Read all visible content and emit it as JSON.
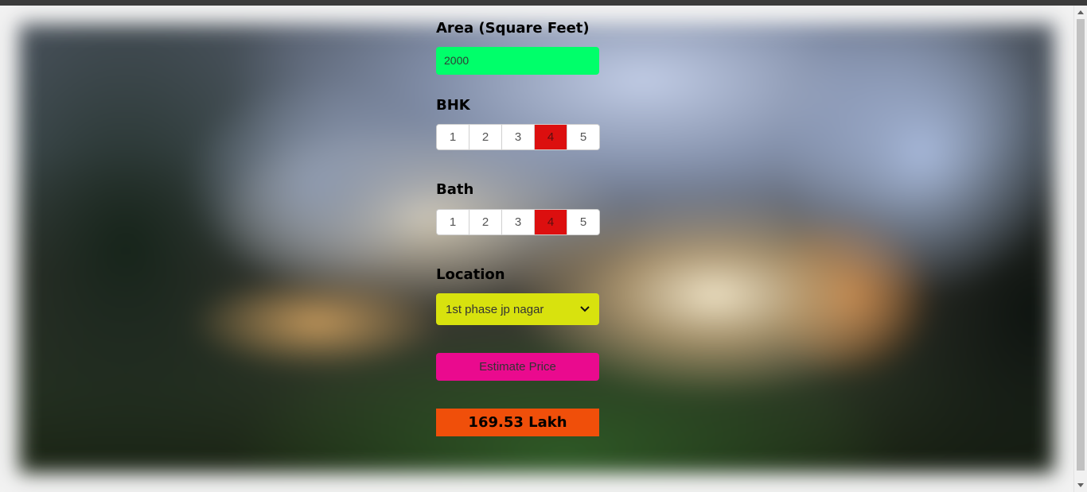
{
  "form": {
    "area": {
      "label": "Area (Square Feet)",
      "value": "2000"
    },
    "bhk": {
      "label": "BHK",
      "options": [
        "1",
        "2",
        "3",
        "4",
        "5"
      ],
      "selected": "4"
    },
    "bath": {
      "label": "Bath",
      "options": [
        "1",
        "2",
        "3",
        "4",
        "5"
      ],
      "selected": "4"
    },
    "location": {
      "label": "Location",
      "selected": "1st phase jp nagar"
    },
    "estimate_button": "Estimate Price",
    "result": "169.53 Lakh"
  },
  "colors": {
    "area_input": "#00ff6a",
    "selected_option": "#dc0f0f",
    "location_select": "#d8e20e",
    "estimate_button": "#ea0a8e",
    "result_box": "#f04f0a"
  },
  "icons": {
    "select_chevron": "chevron-down-icon",
    "scroll_up": "scroll-up-arrow-icon",
    "scroll_down": "scroll-down-arrow-icon"
  }
}
